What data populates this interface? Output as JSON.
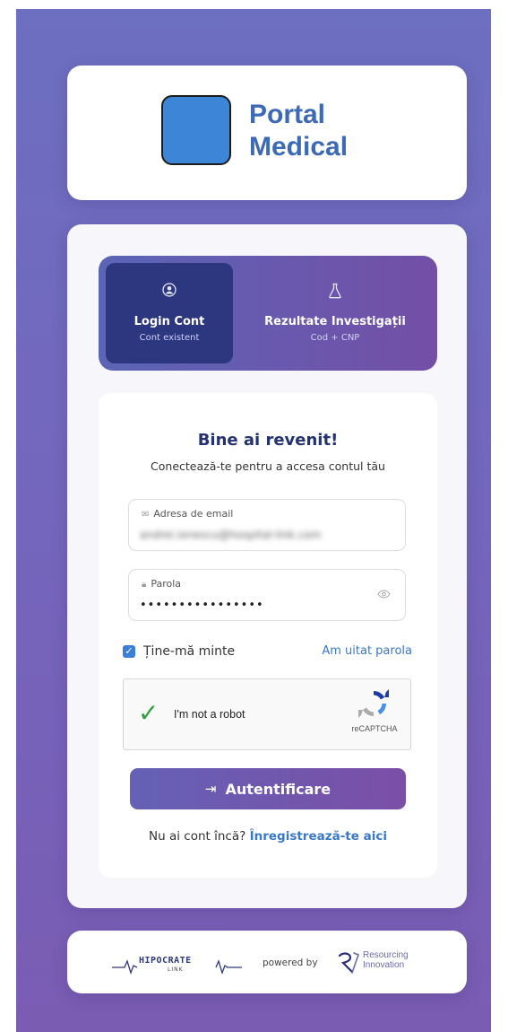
{
  "app": {
    "name_line1": "Portal",
    "name_line2": "Medical"
  },
  "tabs": [
    {
      "icon": "user-circle-icon",
      "title": "Login Cont",
      "subtitle": "Cont existent",
      "active": true
    },
    {
      "icon": "flask-icon",
      "title": "Rezultate Investigații",
      "subtitle": "Cod + CNP",
      "active": false
    }
  ],
  "form": {
    "title": "Bine ai revenit!",
    "subtitle": "Conectează-te pentru a accesa contul tău",
    "email": {
      "icon": "envelope-icon",
      "label": "Adresa de email",
      "value": "andrei.ionescu@hospital-link.com"
    },
    "password": {
      "icon": "lock-icon",
      "label": "Parola",
      "value": "••••••••••••••••",
      "toggle_icon": "eye-icon"
    },
    "remember": {
      "label": "Ține-mă minte",
      "checked": true
    },
    "forgot_link": "Am uitat parola",
    "captcha": {
      "label": "I'm not a robot",
      "brand": "reCAPTCHA",
      "verified": true
    },
    "submit": {
      "icon": "sign-in-icon",
      "label": "Autentificare"
    },
    "register": {
      "prompt": "Nu ai cont încă?",
      "link": "Înregistrează-te aici"
    }
  },
  "footer": {
    "partner_logo": "HIPOCRATE",
    "partner_sub": "LINK",
    "powered_by": "powered by",
    "brand_line1": "Resourcing",
    "brand_line2": "Innovation"
  },
  "colors": {
    "background_top": "#6d6fc0",
    "background_bottom": "#7a5cb3",
    "primary_blue": "#3a78c8",
    "active_tab": "#2c377f",
    "heading": "#243271"
  }
}
